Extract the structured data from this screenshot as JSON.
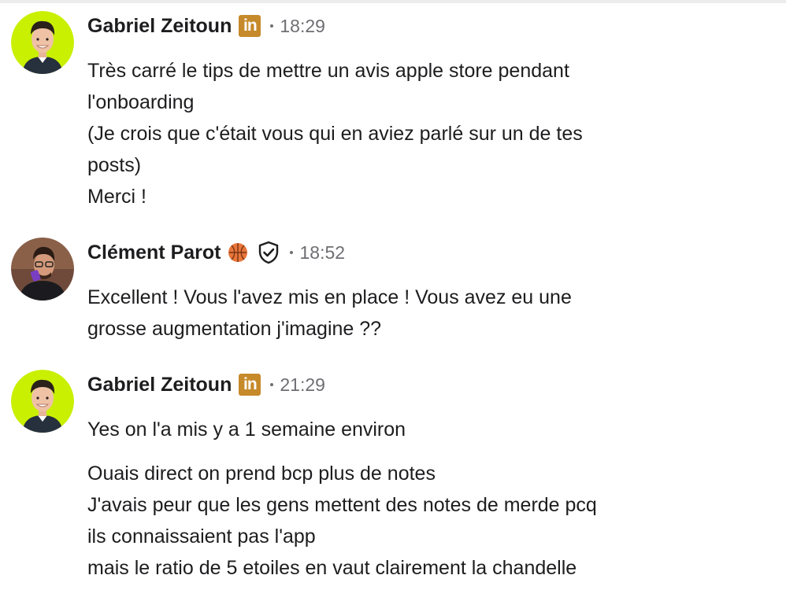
{
  "messages": [
    {
      "author": "Gabriel Zeitoun",
      "badge_icon": "linkedin-icon",
      "badge_text": "in",
      "time": "18:29",
      "paragraphs": [
        [
          "Très carré le tips de mettre un avis apple store pendant",
          "l'onboarding",
          "(Je crois que c'était vous qui en aviez parlé sur un de tes",
          "posts)",
          "Merci !"
        ]
      ]
    },
    {
      "author": "Clément Parot",
      "badge_icon": "basketball-emoji-icon",
      "verified_icon": "shield-check-icon",
      "time": "18:52",
      "paragraphs": [
        [
          "Excellent ! Vous l'avez mis en place ! Vous avez eu une",
          "grosse augmentation j'imagine  ??"
        ]
      ]
    },
    {
      "author": "Gabriel Zeitoun",
      "badge_icon": "linkedin-icon",
      "badge_text": "in",
      "time": "21:29",
      "paragraphs": [
        [
          "Yes on l'a mis y a 1 semaine environ"
        ],
        [
          "Ouais direct on prend bcp plus de notes",
          "J'avais peur que les gens mettent des notes de merde pcq",
          "ils connaissaient pas l'app",
          "mais le ratio de 5 etoiles en vaut clairement la chandelle"
        ]
      ]
    }
  ],
  "colors": {
    "linkedin_badge": "#c68a2a",
    "avatar_ring_gabriel": "#c8f000",
    "text": "#1d1d1f",
    "meta": "#6e6e73"
  }
}
